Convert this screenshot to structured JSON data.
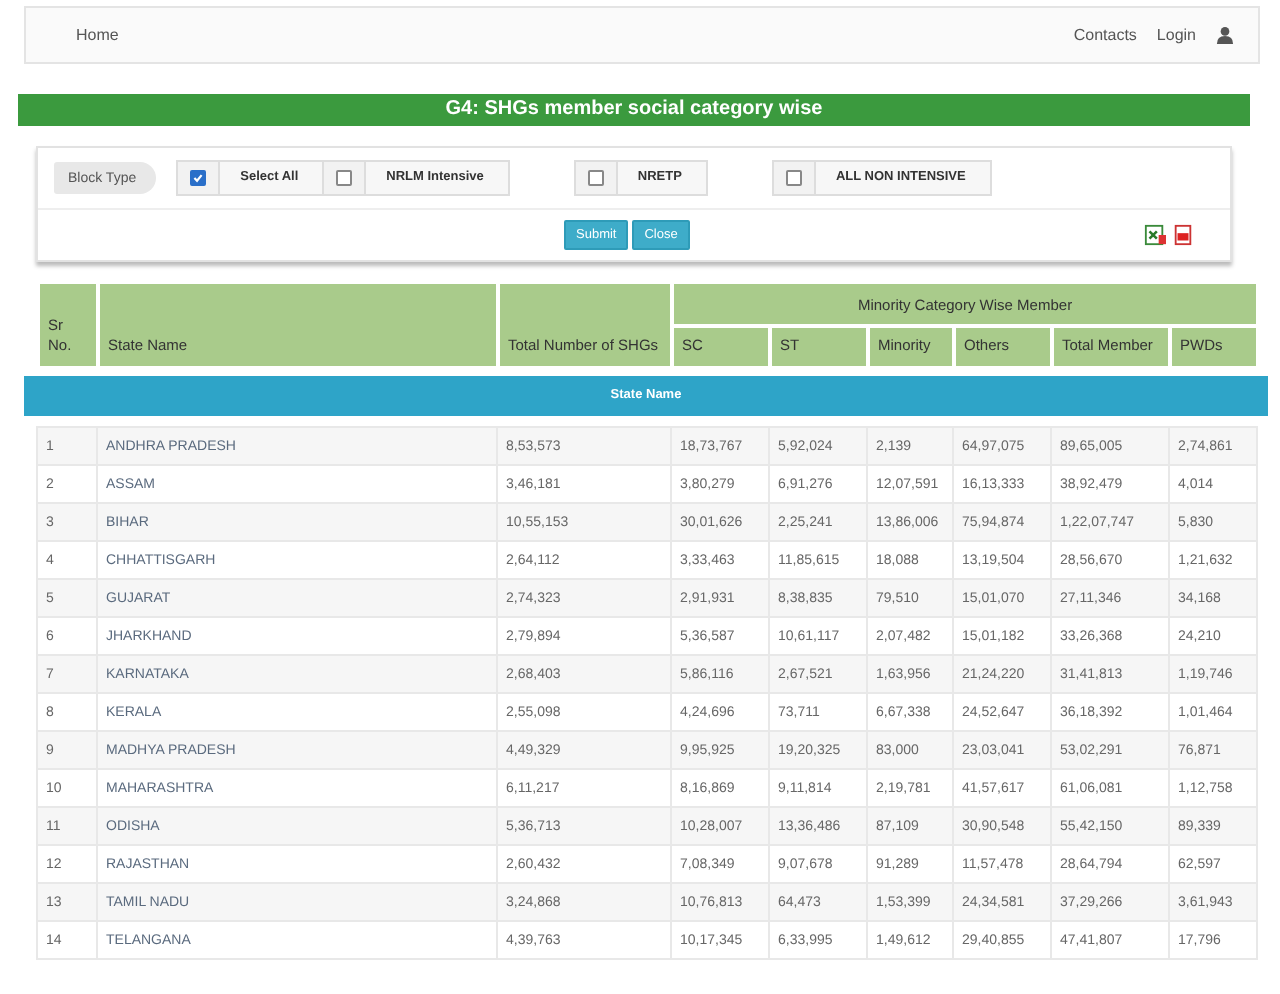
{
  "nav": {
    "left": [
      "Home"
    ],
    "right": [
      "Contacts",
      "Login"
    ]
  },
  "title": "G4: SHGs member social category wise",
  "filter": {
    "label": "Block Type",
    "options": [
      {
        "label": "Select All",
        "checked": true
      },
      {
        "label": "NRLM Intensive",
        "checked": false
      },
      {
        "label": "NRETP",
        "checked": false
      },
      {
        "label": "ALL NON INTENSIVE",
        "checked": false
      }
    ],
    "buttons": [
      "Submit",
      "Close"
    ]
  },
  "table": {
    "columns": [
      "Sr No.",
      "State Name",
      "Total Number of SHGs",
      "SC",
      "ST",
      "Minority",
      "Others",
      "Total Member",
      "PWDs"
    ],
    "group_header": "Minority Category Wise Member",
    "ribbon": "State Name",
    "rows": [
      [
        "1",
        "ANDHRA PRADESH",
        "8,53,573",
        "18,73,767",
        "5,92,024",
        "2,139",
        "64,97,075",
        "89,65,005",
        "2,74,861"
      ],
      [
        "2",
        "ASSAM",
        "3,46,181",
        "3,80,279",
        "6,91,276",
        "12,07,591",
        "16,13,333",
        "38,92,479",
        "4,014"
      ],
      [
        "3",
        "BIHAR",
        "10,55,153",
        "30,01,626",
        "2,25,241",
        "13,86,006",
        "75,94,874",
        "1,22,07,747",
        "5,830"
      ],
      [
        "4",
        "CHHATTISGARH",
        "2,64,112",
        "3,33,463",
        "11,85,615",
        "18,088",
        "13,19,504",
        "28,56,670",
        "1,21,632"
      ],
      [
        "5",
        "GUJARAT",
        "2,74,323",
        "2,91,931",
        "8,38,835",
        "79,510",
        "15,01,070",
        "27,11,346",
        "34,168"
      ],
      [
        "6",
        "JHARKHAND",
        "2,79,894",
        "5,36,587",
        "10,61,117",
        "2,07,482",
        "15,01,182",
        "33,26,368",
        "24,210"
      ],
      [
        "7",
        "KARNATAKA",
        "2,68,403",
        "5,86,116",
        "2,67,521",
        "1,63,956",
        "21,24,220",
        "31,41,813",
        "1,19,746"
      ],
      [
        "8",
        "KERALA",
        "2,55,098",
        "4,24,696",
        "73,711",
        "6,67,338",
        "24,52,647",
        "36,18,392",
        "1,01,464"
      ],
      [
        "9",
        "MADHYA PRADESH",
        "4,49,329",
        "9,95,925",
        "19,20,325",
        "83,000",
        "23,03,041",
        "53,02,291",
        "76,871"
      ],
      [
        "10",
        "MAHARASHTRA",
        "6,11,217",
        "8,16,869",
        "9,11,814",
        "2,19,781",
        "41,57,617",
        "61,06,081",
        "1,12,758"
      ],
      [
        "11",
        "ODISHA",
        "5,36,713",
        "10,28,007",
        "13,36,486",
        "87,109",
        "30,90,548",
        "55,42,150",
        "89,339"
      ],
      [
        "12",
        "RAJASTHAN",
        "2,60,432",
        "7,08,349",
        "9,07,678",
        "91,289",
        "11,57,478",
        "28,64,794",
        "62,597"
      ],
      [
        "13",
        "TAMIL NADU",
        "3,24,868",
        "10,76,813",
        "64,473",
        "1,53,399",
        "24,34,581",
        "37,29,266",
        "3,61,943"
      ],
      [
        "14",
        "TELANGANA",
        "4,39,763",
        "10,17,345",
        "6,33,995",
        "1,49,612",
        "29,40,855",
        "47,41,807",
        "17,796"
      ]
    ]
  }
}
